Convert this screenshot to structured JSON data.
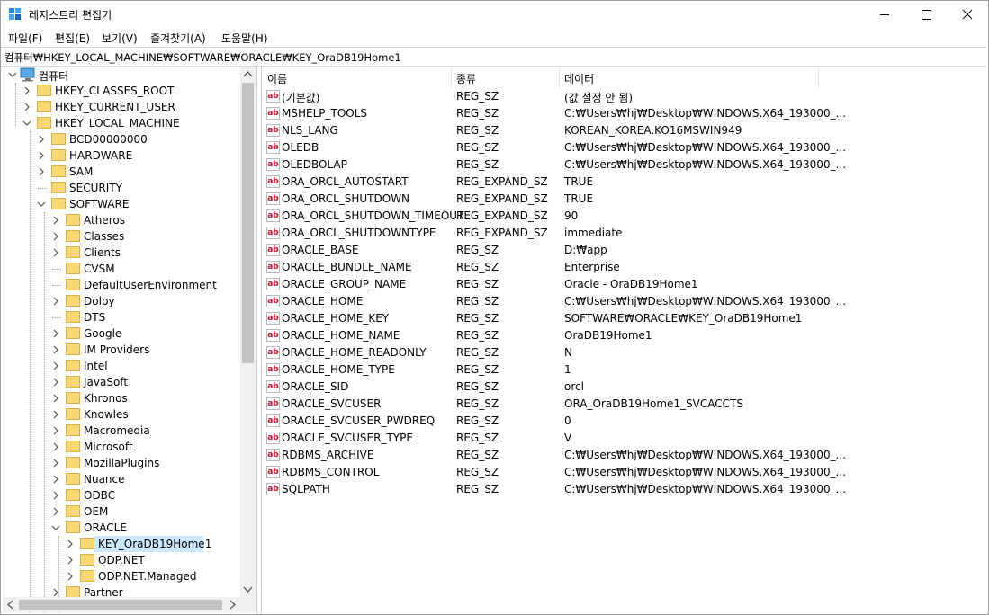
{
  "window": {
    "title": "레지스트리 편집기"
  },
  "menu": [
    "파일(F)",
    "편집(E)",
    "보기(V)",
    "즐겨찾기(A)",
    "도움말(H)"
  ],
  "address": "컴퓨터₩HKEY_LOCAL_MACHINE₩SOFTWARE₩ORACLE₩KEY_OraDB19Home1",
  "tree": {
    "root": "컴퓨터",
    "hives": [
      "HKEY_CLASSES_ROOT",
      "HKEY_CURRENT_USER",
      "HKEY_LOCAL_MACHINE"
    ],
    "hklm_children": [
      "BCD00000000",
      "HARDWARE",
      "SAM",
      "SECURITY",
      "SOFTWARE"
    ],
    "software_children": [
      "Atheros",
      "Classes",
      "Clients",
      "CVSM",
      "DefaultUserEnvironment",
      "Dolby",
      "DTS",
      "Google",
      "IM Providers",
      "Intel",
      "JavaSoft",
      "Khronos",
      "Knowles",
      "Macromedia",
      "Microsoft",
      "MozillaPlugins",
      "Nuance",
      "ODBC",
      "OEM",
      "ORACLE"
    ],
    "oracle_children": [
      "KEY_OraDB19Home1",
      "ODP.NET",
      "ODP.NET.Managed"
    ],
    "after_oracle": [
      "Partner"
    ],
    "selected": "KEY_OraDB19Home1"
  },
  "columns": {
    "name": "이름",
    "type": "종류",
    "data": "데이터"
  },
  "values": [
    {
      "name": "(기본값)",
      "type": "REG_SZ",
      "data": "(값 설정 안 됨)"
    },
    {
      "name": "MSHELP_TOOLS",
      "type": "REG_SZ",
      "data": "C:₩Users₩hj₩Desktop₩WINDOWS.X64_193000_..."
    },
    {
      "name": "NLS_LANG",
      "type": "REG_SZ",
      "data": "KOREAN_KOREA.KO16MSWIN949"
    },
    {
      "name": "OLEDB",
      "type": "REG_SZ",
      "data": "C:₩Users₩hj₩Desktop₩WINDOWS.X64_193000_..."
    },
    {
      "name": "OLEDBOLAP",
      "type": "REG_SZ",
      "data": "C:₩Users₩hj₩Desktop₩WINDOWS.X64_193000_..."
    },
    {
      "name": "ORA_ORCL_AUTOSTART",
      "type": "REG_EXPAND_SZ",
      "data": "TRUE"
    },
    {
      "name": "ORA_ORCL_SHUTDOWN",
      "type": "REG_EXPAND_SZ",
      "data": "TRUE"
    },
    {
      "name": "ORA_ORCL_SHUTDOWN_TIMEOUT",
      "type": "REG_EXPAND_SZ",
      "data": "90"
    },
    {
      "name": "ORA_ORCL_SHUTDOWNTYPE",
      "type": "REG_EXPAND_SZ",
      "data": "immediate"
    },
    {
      "name": "ORACLE_BASE",
      "type": "REG_SZ",
      "data": "D:₩app"
    },
    {
      "name": "ORACLE_BUNDLE_NAME",
      "type": "REG_SZ",
      "data": "Enterprise"
    },
    {
      "name": "ORACLE_GROUP_NAME",
      "type": "REG_SZ",
      "data": "Oracle - OraDB19Home1"
    },
    {
      "name": "ORACLE_HOME",
      "type": "REG_SZ",
      "data": "C:₩Users₩hj₩Desktop₩WINDOWS.X64_193000_..."
    },
    {
      "name": "ORACLE_HOME_KEY",
      "type": "REG_SZ",
      "data": "SOFTWARE₩ORACLE₩KEY_OraDB19Home1"
    },
    {
      "name": "ORACLE_HOME_NAME",
      "type": "REG_SZ",
      "data": "OraDB19Home1"
    },
    {
      "name": "ORACLE_HOME_READONLY",
      "type": "REG_SZ",
      "data": "N"
    },
    {
      "name": "ORACLE_HOME_TYPE",
      "type": "REG_SZ",
      "data": "1"
    },
    {
      "name": "ORACLE_SID",
      "type": "REG_SZ",
      "data": "orcl"
    },
    {
      "name": "ORACLE_SVCUSER",
      "type": "REG_SZ",
      "data": "ORA_OraDB19Home1_SVCACCTS"
    },
    {
      "name": "ORACLE_SVCUSER_PWDREQ",
      "type": "REG_SZ",
      "data": "0"
    },
    {
      "name": "ORACLE_SVCUSER_TYPE",
      "type": "REG_SZ",
      "data": "V"
    },
    {
      "name": "RDBMS_ARCHIVE",
      "type": "REG_SZ",
      "data": "C:₩Users₩hj₩Desktop₩WINDOWS.X64_193000_..."
    },
    {
      "name": "RDBMS_CONTROL",
      "type": "REG_SZ",
      "data": "C:₩Users₩hj₩Desktop₩WINDOWS.X64_193000_..."
    },
    {
      "name": "SQLPATH",
      "type": "REG_SZ",
      "data": "C:₩Users₩hj₩Desktop₩WINDOWS.X64_193000_..."
    }
  ],
  "value_icon": "ab",
  "colors": {
    "folder": "#f8d775",
    "selection": "#cce8ff",
    "icon_red": "#c8102e"
  }
}
